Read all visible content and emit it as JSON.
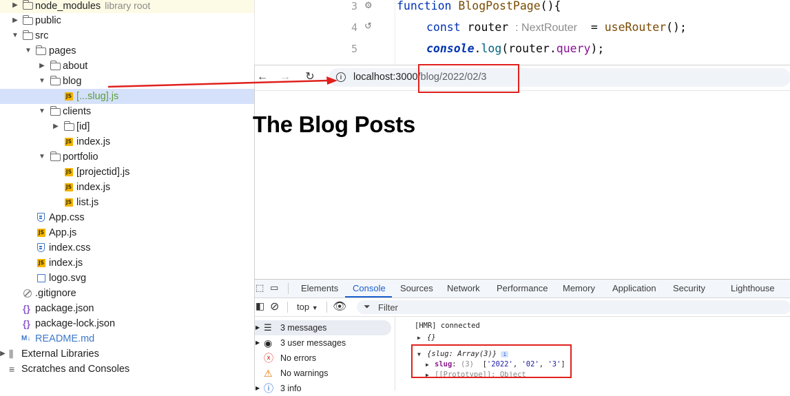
{
  "tree": {
    "items": [
      {
        "label": "node_modules",
        "hint": "library root"
      },
      {
        "label": "public"
      },
      {
        "label": "src"
      },
      {
        "label": "pages"
      },
      {
        "label": "about"
      },
      {
        "label": "blog"
      },
      {
        "label": "[...slug].js"
      },
      {
        "label": "clients"
      },
      {
        "label": "[id]"
      },
      {
        "label": "index.js"
      },
      {
        "label": "portfolio"
      },
      {
        "label": "[projectid].js"
      },
      {
        "label": "index.js"
      },
      {
        "label": "list.js"
      },
      {
        "label": "App.css"
      },
      {
        "label": "App.js"
      },
      {
        "label": "index.css"
      },
      {
        "label": "index.js"
      },
      {
        "label": "logo.svg"
      },
      {
        "label": ".gitignore"
      },
      {
        "label": "package.json"
      },
      {
        "label": "package-lock.json"
      },
      {
        "label": "README.md"
      },
      {
        "label": "External Libraries"
      },
      {
        "label": "Scratches and Consoles"
      }
    ]
  },
  "editor": {
    "line_numbers": [
      "3",
      "4",
      "5"
    ],
    "line3": {
      "kw": "function",
      "name": "BlogPostPage",
      "rest": "(){"
    },
    "line4": {
      "kw": "const",
      "var": " router ",
      "type_hint": ": NextRouter",
      "eq": "  = ",
      "call": "useRouter",
      "end": "();"
    },
    "line5": {
      "obj": "console",
      "dot": ".",
      "method": "log",
      "open": "(router.",
      "prop": "query",
      "end": ");"
    }
  },
  "browser": {
    "url_host": "localhost:3000",
    "url_path": "/blog/2022/02/3",
    "page_heading": "The Blog Posts"
  },
  "devtools": {
    "tabs": [
      "Elements",
      "Console",
      "Sources",
      "Network",
      "Performance",
      "Memory",
      "Application",
      "Security",
      "Lighthouse"
    ],
    "context": "top",
    "filter_placeholder": "Filter",
    "sidebar": [
      {
        "label": "3 messages",
        "icon": "list-icon"
      },
      {
        "label": "3 user messages",
        "icon": "user-icon"
      },
      {
        "label": "No errors",
        "icon": "error-icon"
      },
      {
        "label": "No warnings",
        "icon": "warning-icon"
      },
      {
        "label": "3 info",
        "icon": "info-icon"
      }
    ],
    "console": {
      "line1": "[HMR] connected",
      "line2": "{}",
      "line3_obj": "{slug: Array(3)}",
      "line3_badge": "i",
      "line4_key": "slug",
      "line4_len": "(3)",
      "line4_vals": [
        "'2022'",
        "'02'",
        "'3'"
      ],
      "line5": "[[Prototype]]: Object"
    }
  }
}
